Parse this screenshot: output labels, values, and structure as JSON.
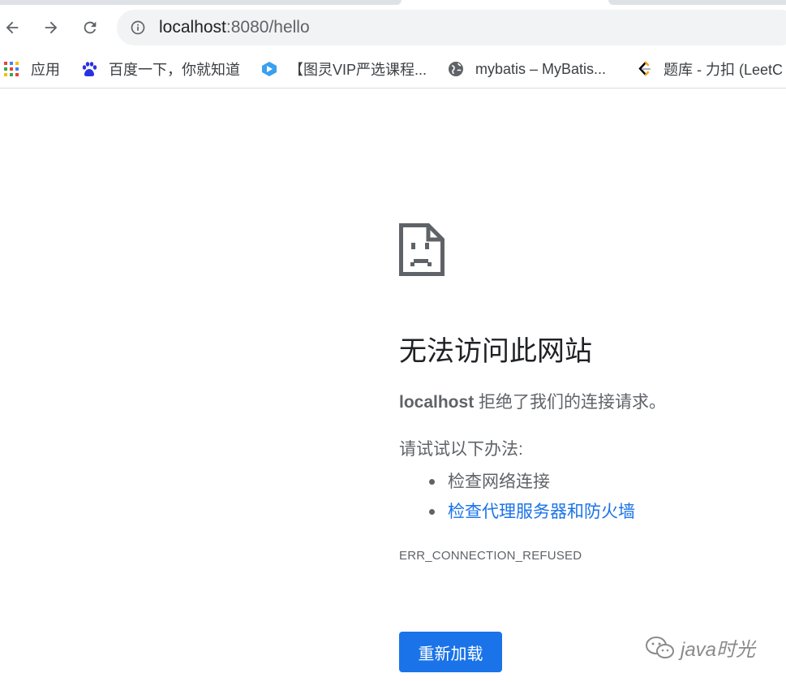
{
  "browser": {
    "address_bar": {
      "url_host": "localhost",
      "url_rest": ":8080/hello"
    },
    "bookmarks": [
      {
        "label": "应用",
        "icon": "apps-grid-icon"
      },
      {
        "label": "百度一下，你就知道",
        "icon": "baidu-paw-icon"
      },
      {
        "label": "【图灵VIP严选课程...",
        "icon": "tuling-icon"
      },
      {
        "label": "mybatis – MyBatis...",
        "icon": "globe-icon"
      },
      {
        "label": "题库 - 力扣 (LeetC",
        "icon": "leetcode-icon"
      }
    ]
  },
  "error_page": {
    "title": "无法访问此网站",
    "host": "localhost",
    "description": " 拒绝了我们的连接请求。",
    "suggestions_heading": "请试试以下办法:",
    "suggestions": [
      {
        "text": "检查网络连接",
        "link": false
      },
      {
        "text": "检查代理服务器和防火墙",
        "link": true
      }
    ],
    "error_code": "ERR_CONNECTION_REFUSED",
    "reload_label": "重新加载"
  },
  "watermark": {
    "text": "java时光"
  },
  "colors": {
    "link": "#1a73e8",
    "button_bg": "#1a73e8",
    "secondary_text": "#5f6368"
  }
}
